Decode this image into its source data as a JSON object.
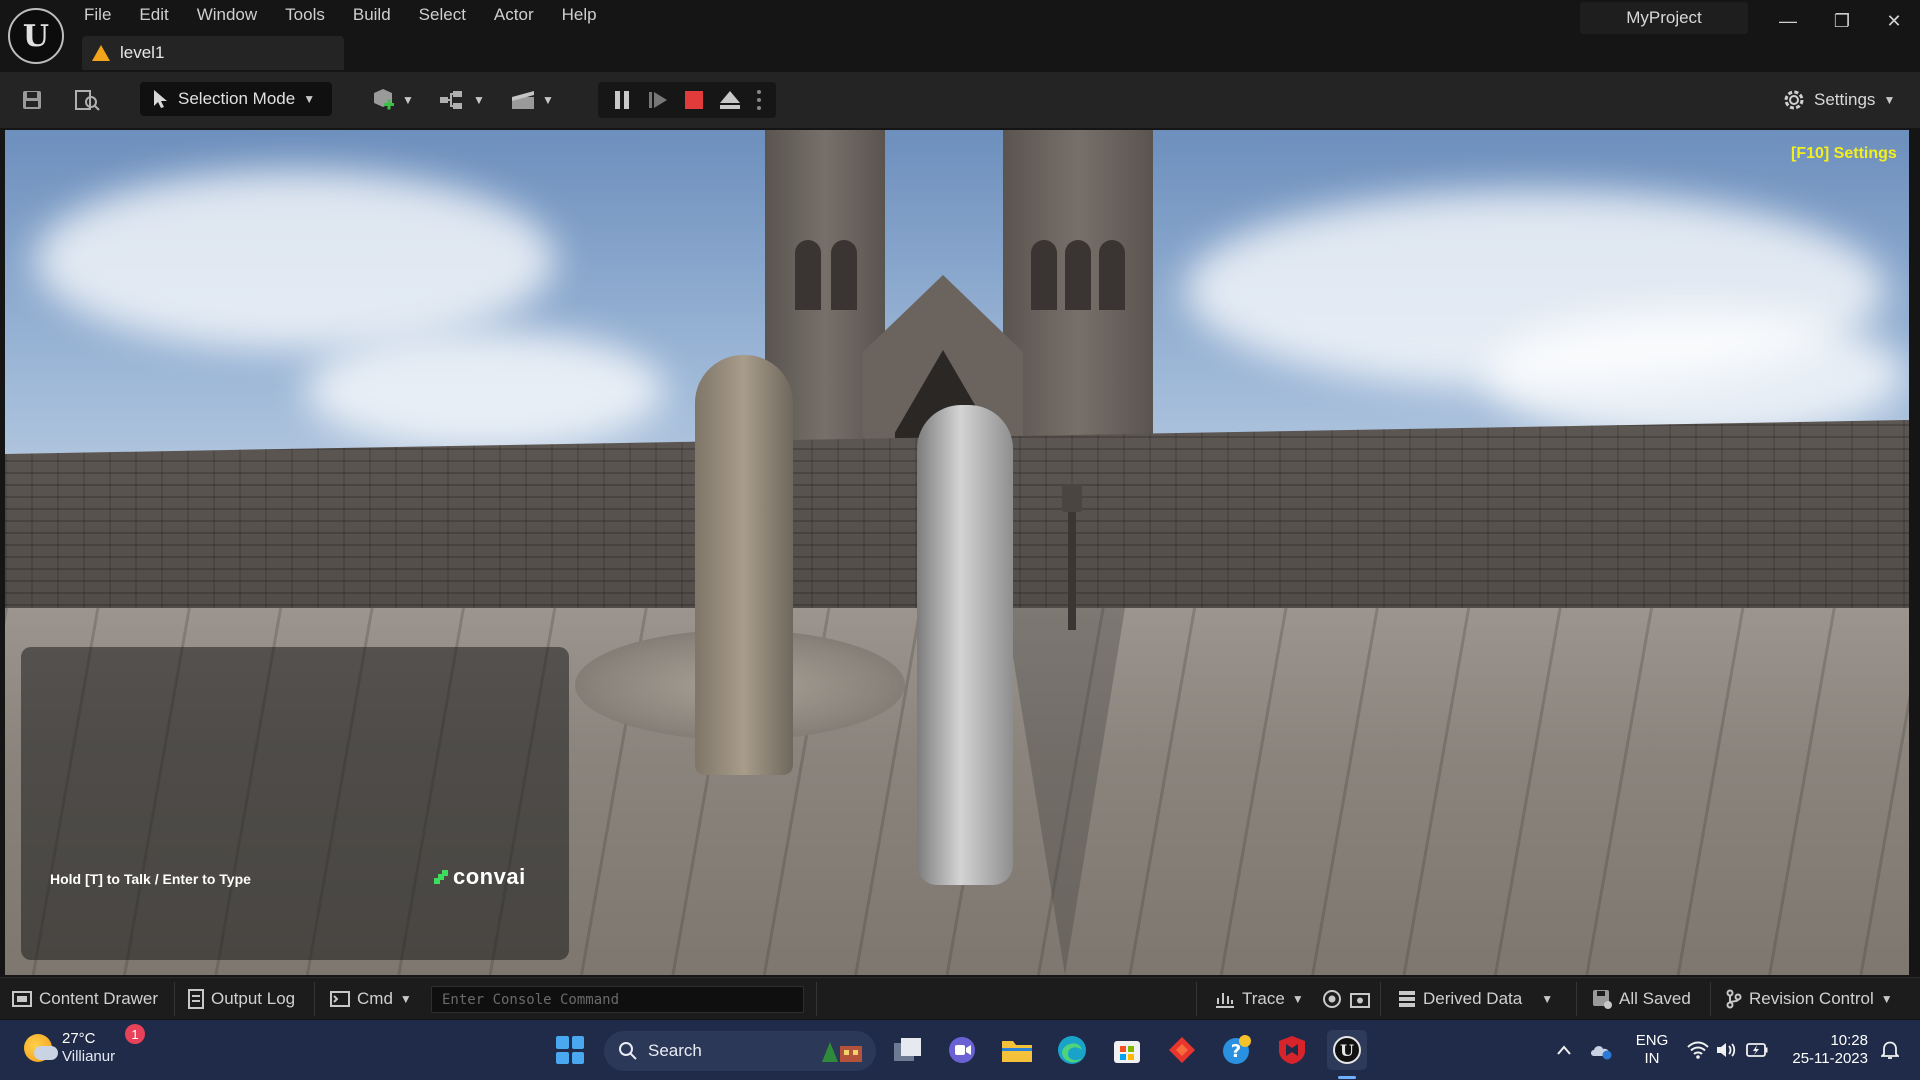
{
  "app": {
    "logo_letter": "U",
    "project_name": "MyProject",
    "menu": [
      "File",
      "Edit",
      "Window",
      "Tools",
      "Build",
      "Select",
      "Actor",
      "Help"
    ],
    "level_tab": "level1",
    "window_controls": {
      "minimize": "—",
      "restore": "❐",
      "close": "✕"
    }
  },
  "toolbar": {
    "selection_mode": "Selection Mode",
    "settings": "Settings",
    "icons": [
      "save-icon",
      "browse-icon",
      "add-actor-icon",
      "blueprint-icon",
      "cinematics-icon",
      "pause-icon",
      "skip-frame-icon",
      "stop-icon",
      "eject-icon",
      "more-options-icon",
      "settings-icon"
    ],
    "stop_color": "#e23b3b"
  },
  "viewport": {
    "overlay_settings": "[F10] Settings",
    "overlay_color": "#f3ef1d",
    "convai_hint": "Hold [T] to Talk / Enter to Type",
    "convai_logo": "convai",
    "convai_color": "#3ddc5c"
  },
  "statusbar": {
    "content_drawer": "Content Drawer",
    "output_log": "Output Log",
    "cmd": "Cmd",
    "console_placeholder": "Enter Console Command",
    "trace": "Trace",
    "derived_data": "Derived Data",
    "all_saved": "All Saved",
    "revision_control": "Revision Control"
  },
  "taskbar": {
    "weather_temp": "27°C",
    "weather_place": "Villianur",
    "weather_badge": "1",
    "search": "Search",
    "lang_top": "ENG",
    "lang_bottom": "IN",
    "time": "10:28",
    "date": "25-11-2023",
    "pinned": [
      "task-view-icon",
      "teams-icon",
      "file-explorer-icon",
      "edge-icon",
      "store-icon",
      "anydesk-icon",
      "chrome-helper-icon",
      "mcafee-icon",
      "unreal-engine-icon"
    ]
  }
}
